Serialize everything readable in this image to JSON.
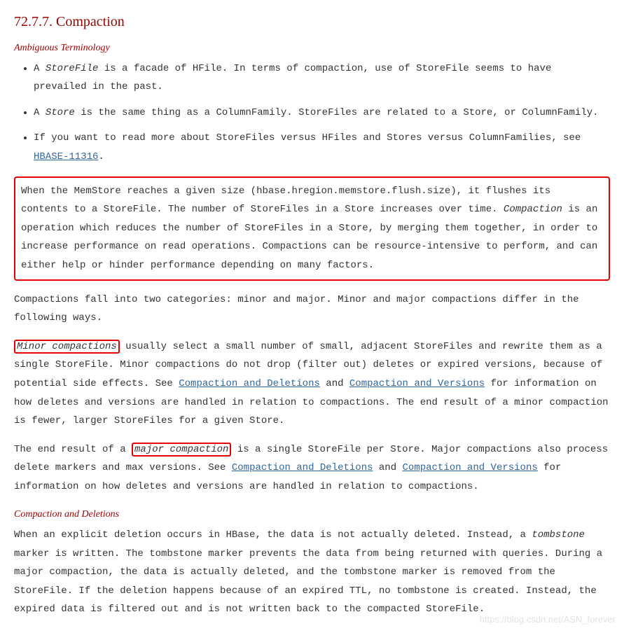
{
  "title": "72.7.7. Compaction",
  "sub1": "Ambiguous Terminology",
  "bullets": {
    "b1a": "A ",
    "b1b": "StoreFile",
    "b1c": " is a facade of HFile. In terms of compaction, use of StoreFile seems to have prevailed in the past.",
    "b2a": "A ",
    "b2b": "Store",
    "b2c": " is the same thing as a ColumnFamily. StoreFiles are related to a Store, or ColumnFamily.",
    "b3a": "If you want to read more about StoreFiles versus HFiles and Stores versus ColumnFamilies, see ",
    "b3link": "HBASE-11316",
    "b3b": "."
  },
  "box1": {
    "t1": "When the MemStore reaches a given size (",
    "code": "hbase.hregion.memstore.flush.size",
    "t2": "), it flushes its contents to a StoreFile. The number of StoreFiles in a Store increases over time. ",
    "em": "Compaction",
    "t3": " is an operation which reduces the number of StoreFiles in a Store, by merging them together, in order to increase performance on read operations. Compactions can be resource-intensive to perform, and can either help or hinder performance depending on many factors."
  },
  "p2": "Compactions fall into two categories: minor and major. Minor and major compactions differ in the following ways.",
  "p3": {
    "hl": "Minor compactions",
    "t1": " usually select a small number of small, adjacent StoreFiles and rewrite them as a single StoreFile. Minor compactions do not drop (filter out) deletes or expired versions, because of potential side effects. See ",
    "l1": "Compaction and Deletions",
    "t2": " and ",
    "l2": "Compaction and Versions",
    "t3": " for information on how deletes and versions are handled in relation to compactions. The end result of a minor compaction is fewer, larger StoreFiles for a given Store."
  },
  "p4": {
    "t1": "The end result of a ",
    "hl": "major compaction",
    "t2": " is a single StoreFile per Store. Major compactions also process delete markers and max versions. See ",
    "l1": "Compaction and Deletions",
    "t3": " and ",
    "l2": "Compaction and Versions",
    "t4": " for information on how deletes and versions are handled in relation to compactions."
  },
  "sub2": "Compaction and Deletions",
  "p5": {
    "t1": "When an explicit deletion occurs in HBase, the data is not actually deleted. Instead, a ",
    "em": "tombstone",
    "t2": " marker is written. The tombstone marker prevents the data from being returned with queries. During a major compaction, the data is actually deleted, and the tombstone marker is removed from the StoreFile. If the deletion happens because of an expired TTL, no tombstone is created. Instead, the expired data is filtered out and is not written back to the compacted StoreFile."
  },
  "watermark": "https://blog.csdn.net/ASN_forever"
}
